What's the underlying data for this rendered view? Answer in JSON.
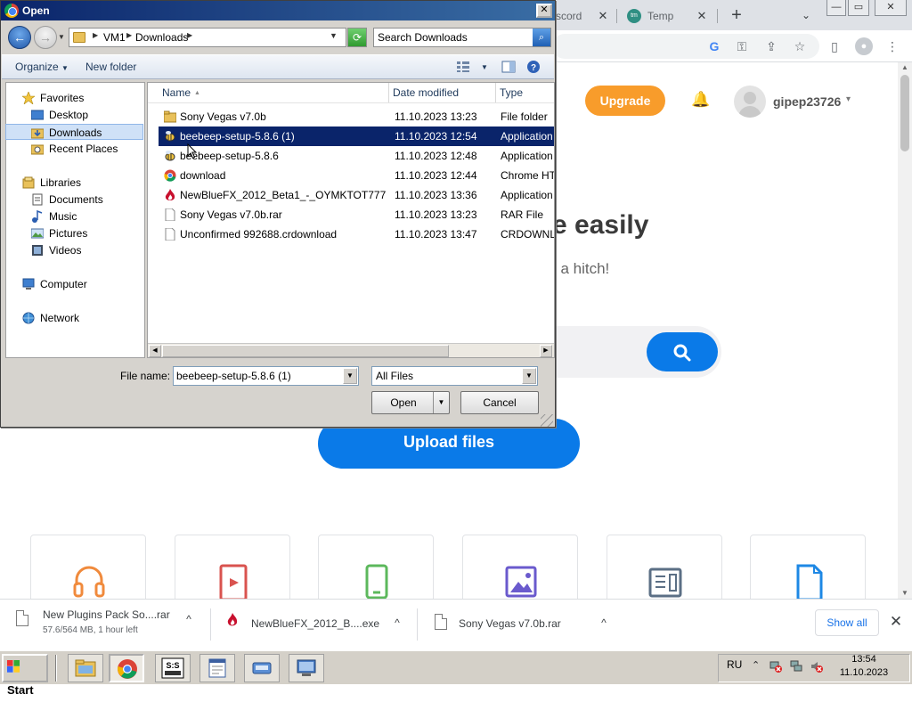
{
  "browser": {
    "tabs": [
      {
        "label": "scord",
        "close": "✕"
      },
      {
        "label": "Temp Mai",
        "favicon": "tm",
        "close": "✕"
      }
    ],
    "new_tab": "+",
    "tab_search": "⌄",
    "window_controls": {
      "minimize": "—",
      "maximize": "▭",
      "close": "✕"
    },
    "toolbar_icons": {
      "google": "G",
      "key": "⚿",
      "share": "⇪",
      "star": "☆",
      "sidebar": "▯",
      "profile": "●",
      "menu": "⋮"
    }
  },
  "page": {
    "upgrade_label": "Upgrade",
    "bell": "🔔",
    "username": "gipep23726",
    "user_caret": "▾",
    "hero_title": "e easily",
    "hero_sub": "t a hitch!",
    "search_icon": "🔍",
    "upload_label": "Upload files",
    "cards": [
      {
        "icon": "headphones-icon",
        "color": "#f08a3c"
      },
      {
        "icon": "video-icon",
        "color": "#d9534f"
      },
      {
        "icon": "phone-icon",
        "color": "#5cb85c"
      },
      {
        "icon": "image-icon",
        "color": "#6a5acd"
      },
      {
        "icon": "document-icon",
        "color": "#5b6f85"
      },
      {
        "icon": "file-icon",
        "color": "#1e88e5"
      }
    ]
  },
  "downloads": [
    {
      "name": "New Plugins Pack So....rar",
      "status": "57.6/564 MB, 1 hour left"
    },
    {
      "name": "NewBlueFX_2012_B....exe",
      "status": ""
    },
    {
      "name": "Sony Vegas v7.0b.rar",
      "status": ""
    }
  ],
  "downloads_bar": {
    "show_all": "Show all",
    "close": "✕",
    "chevron": "^"
  },
  "dialog": {
    "title": "Open",
    "close": "✕",
    "path": [
      "VM1",
      "Downloads"
    ],
    "search_placeholder": "Search Downloads",
    "organize": "Organize",
    "new_folder": "New folder",
    "organize_caret": "▼",
    "nav": {
      "favorites_label": "Favorites",
      "favorites": [
        "Desktop",
        "Downloads",
        "Recent Places"
      ],
      "libraries_label": "Libraries",
      "libraries": [
        "Documents",
        "Music",
        "Pictures",
        "Videos"
      ],
      "computer": "Computer",
      "network": "Network",
      "selected": "Downloads"
    },
    "columns": {
      "name": "Name",
      "date": "Date modified",
      "type": "Type"
    },
    "files": [
      {
        "name": "Sony Vegas v7.0b",
        "date": "11.10.2023 13:23",
        "type": "File folder",
        "icon": "folder-icon"
      },
      {
        "name": "beebeep-setup-5.8.6 (1)",
        "date": "11.10.2023 12:54",
        "type": "Application",
        "icon": "bee-icon",
        "selected": true
      },
      {
        "name": "beebeep-setup-5.8.6",
        "date": "11.10.2023 12:48",
        "type": "Application",
        "icon": "bee-icon"
      },
      {
        "name": "download",
        "date": "11.10.2023 12:44",
        "type": "Chrome HTM",
        "icon": "chrome-icon"
      },
      {
        "name": "NewBlueFX_2012_Beta1_-_OYMKTOT777",
        "date": "11.10.2023 13:36",
        "type": "Application",
        "icon": "flame-icon"
      },
      {
        "name": "Sony Vegas v7.0b.rar",
        "date": "11.10.2023 13:23",
        "type": "RAR File",
        "icon": "file-icon"
      },
      {
        "name": "Unconfirmed 992688.crdownload",
        "date": "11.10.2023 13:47",
        "type": "CRDOWNLO",
        "icon": "file-icon"
      }
    ],
    "file_name_label": "File name:",
    "file_name_value": "beebeep-setup-5.8.6 (1)",
    "file_type_value": "All Files",
    "open_label": "Open",
    "cancel_label": "Cancel"
  },
  "taskbar": {
    "start_label": "Start",
    "language": "RU",
    "time": "13:54",
    "date": "11.10.2023",
    "tray_chevron": "⌃"
  }
}
